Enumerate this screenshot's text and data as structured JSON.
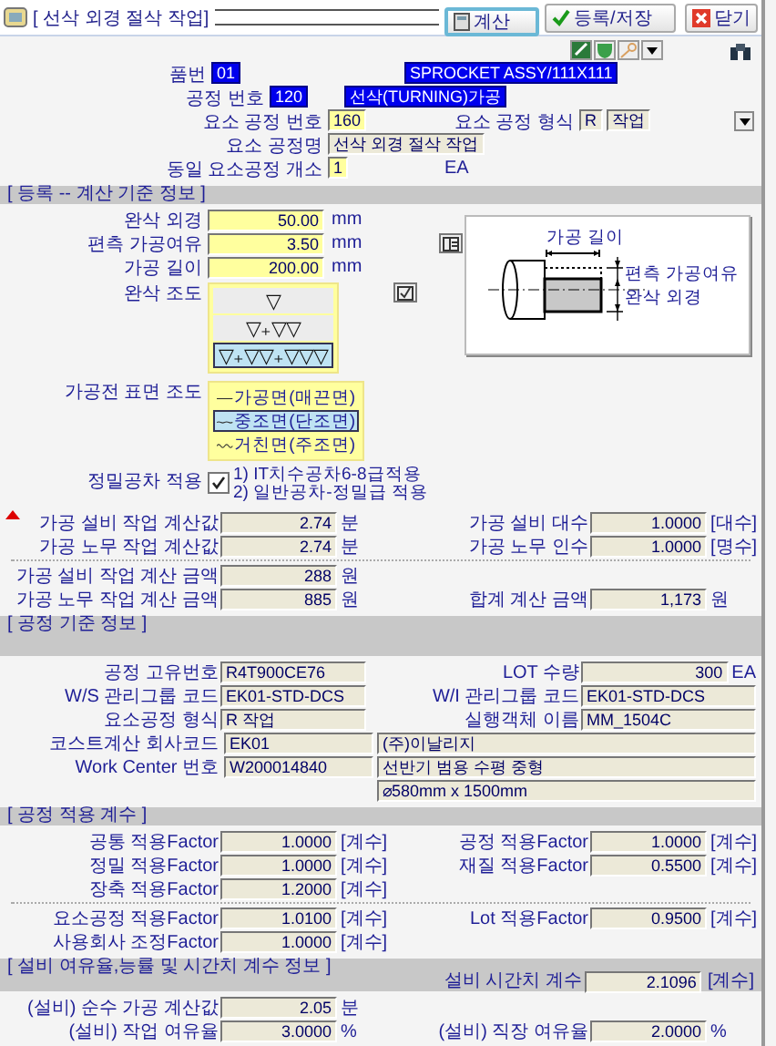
{
  "window": {
    "title": "[ 선삭 외경 절삭 작업]"
  },
  "title_buttons": [
    {
      "label": "계산",
      "kind": "calc",
      "selected": true
    },
    {
      "label": "등록/저장",
      "kind": "save",
      "selected": false
    },
    {
      "label": "닫기",
      "kind": "close",
      "selected": false
    }
  ],
  "header": [
    {
      "label": "품번",
      "fields": [
        {
          "value": "01",
          "kind": "highlight"
        },
        {
          "value": "SPROCKET ASSY/111X111",
          "kind": "highlight"
        }
      ]
    },
    {
      "label": "공정 번호",
      "fields": [
        {
          "value": "120",
          "kind": "highlight"
        },
        {
          "value": "선삭(TURNING)가공",
          "kind": "highlight"
        }
      ]
    },
    {
      "label": "요소 공정 번호",
      "fields": [
        {
          "value": "160",
          "kind": "input"
        }
      ],
      "right": {
        "label": "요소 공정 형식",
        "fields": [
          {
            "value": "R",
            "kind": "display"
          },
          {
            "value": "작업",
            "kind": "display"
          }
        ],
        "dropdown": true
      }
    },
    {
      "label": "요소 공정명",
      "fields": [
        {
          "value": "선삭 외경 절삭 작업",
          "kind": "display"
        }
      ]
    },
    {
      "label": "동일 요소공정 개소",
      "fields": [
        {
          "value": "1",
          "kind": "input"
        }
      ],
      "unit": "EA"
    }
  ],
  "registration": {
    "title": "[ 등록 -- 계산 기준 정보 ]",
    "fields": [
      {
        "label": "완삭 외경",
        "value": "50.00",
        "unit": "mm"
      },
      {
        "label": "편측 가공여유",
        "value": "3.50",
        "unit": "mm"
      },
      {
        "label": "가공 길이",
        "value": "200.00",
        "unit": "mm"
      }
    ],
    "diagram": {
      "length": "가공 길이",
      "allowance": "편측 가공여유",
      "diameter": "완삭 외경"
    },
    "roughness": {
      "label": "완삭 조도",
      "options": [
        {
          "label": "▽",
          "selected": false
        },
        {
          "label": "▽₊▽▽",
          "selected": false
        },
        {
          "label": "▽₊▽▽₊▽▽▽",
          "selected": true
        }
      ]
    },
    "surface": {
      "label": "가공전 표면 조도",
      "options": [
        {
          "label": "가공면(매끈면)",
          "kind": "smooth",
          "selected": false
        },
        {
          "label": "중조면(단조면)",
          "kind": "medium",
          "selected": true
        },
        {
          "label": "거친면(주조면)",
          "kind": "rough",
          "selected": false
        }
      ]
    },
    "precision": {
      "label": "정밀공차 적용",
      "checked": true,
      "notes": [
        "1) IT치수공차6-8급적용",
        "2) 일반공차-정밀급 적용"
      ]
    },
    "calc_groups": [
      [
        {
          "left": {
            "label": "가공 설비 작업 계산값",
            "value": "2.74",
            "unit": "분"
          },
          "right": {
            "label": "가공 설비 대수",
            "value": "1.0000",
            "unit": "[대수]"
          }
        },
        {
          "left": {
            "label": "가공 노무 작업 계산값",
            "value": "2.74",
            "unit": "분"
          },
          "right": {
            "label": "가공 노무 인수",
            "value": "1.0000",
            "unit": "[명수]"
          }
        }
      ],
      [
        {
          "left": {
            "label": "가공 설비 작업 계산 금액",
            "value": "288",
            "unit": "원"
          }
        },
        {
          "left": {
            "label": "가공 노무 작업 계산 금액",
            "value": "885",
            "unit": "원"
          },
          "right": {
            "label": "합계 계산 금액",
            "value": "1,173",
            "unit": "원"
          }
        }
      ]
    ]
  },
  "process_info": {
    "title": "[ 공정 기준 정보 ]",
    "rows": [
      {
        "kind": "pair",
        "left": {
          "label": "공정 고유번호",
          "value": "R4T900CE76"
        },
        "right": {
          "label": "LOT 수량",
          "value": "300",
          "unit": "EA"
        }
      },
      {
        "kind": "pair",
        "left": {
          "label": "W/S 관리그룹 코드",
          "value": "EK01-STD-DCS"
        },
        "right": {
          "label": "W/I 관리그룹 코드",
          "value": "EK01-STD-DCS"
        }
      },
      {
        "kind": "pair",
        "left": {
          "label": "요소공정 형식",
          "value": "R  작업"
        },
        "right": {
          "label": "실행객체 이름",
          "value": "MM_1504C"
        }
      },
      {
        "kind": "wide",
        "label": "코스트계산 회사코드",
        "value": "EK01",
        "name": "(주)이날리지"
      },
      {
        "kind": "wide",
        "label": "Work Center 번호",
        "value": "W200014840",
        "name": "선반기 범용 수평 중형"
      },
      {
        "kind": "wide",
        "name": "⌀580mm x 1500mm"
      }
    ]
  },
  "factors": {
    "title": "[ 공정 적용 계수 ]",
    "groups": [
      [
        {
          "left": {
            "label": "공통 적용Factor",
            "value": "1.0000",
            "unit": "[계수]"
          },
          "right": {
            "label": "공정 적용Factor",
            "value": "1.0000",
            "unit": "[계수]"
          }
        },
        {
          "left": {
            "label": "정밀 적용Factor",
            "value": "1.0000",
            "unit": "[계수]"
          },
          "right": {
            "label": "재질 적용Factor",
            "value": "0.5500",
            "unit": "[계수]"
          }
        },
        {
          "left": {
            "label": "장축 적용Factor",
            "value": "1.2000",
            "unit": "[계수]"
          }
        }
      ],
      [
        {
          "left": {
            "label": "요소공정 적용Factor",
            "value": "1.0100",
            "unit": "[계수]"
          },
          "right": {
            "label": "Lot 적용Factor",
            "value": "0.9500",
            "unit": "[계수]"
          }
        },
        {
          "left": {
            "label": "사용회사 조정Factor",
            "value": "1.0000",
            "unit": "[계수]"
          }
        }
      ]
    ]
  },
  "equipment": {
    "title": "[ 설비 여유율,능률 및 시간치 계수 정보 ]",
    "header_field": {
      "label": "설비 시간치 계수",
      "value": "2.1096",
      "unit": "[계수]"
    },
    "rows": [
      {
        "left": {
          "label": "(설비) 순수 가공 계산값",
          "value": "2.05",
          "unit": "분"
        }
      },
      {
        "left": {
          "label": "(설비) 작업 여유율",
          "value": "3.0000",
          "unit": "%"
        },
        "right": {
          "label": "(설비) 직장 여유율",
          "value": "2.0000",
          "unit": "%"
        }
      }
    ]
  }
}
